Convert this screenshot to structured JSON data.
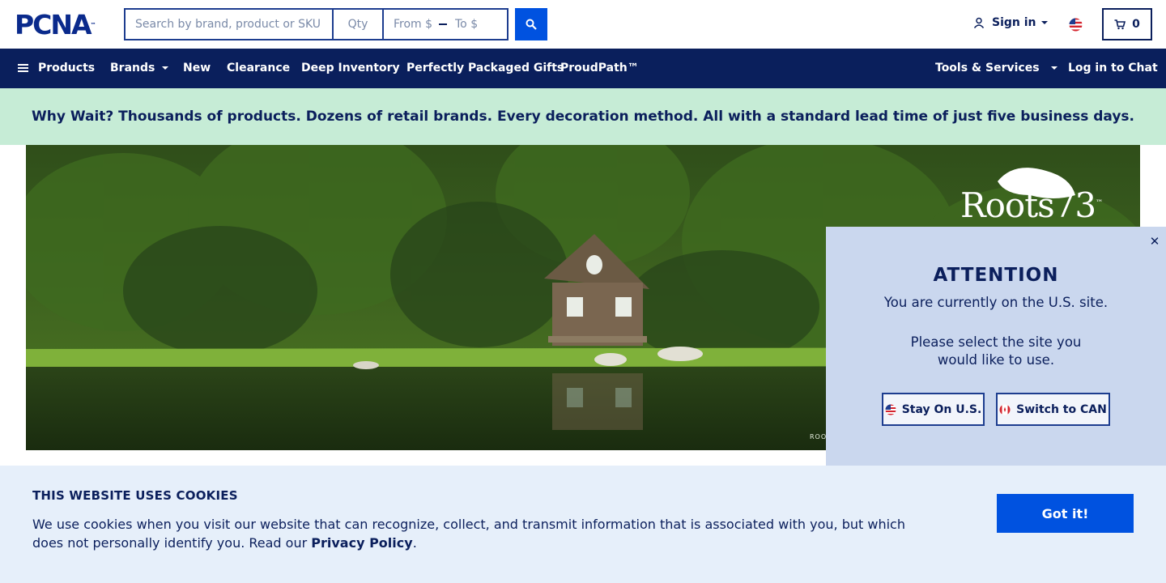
{
  "header": {
    "logo": "PCNA",
    "logo_mark": "™",
    "search": {
      "placeholder": "Search by brand, product or SKU",
      "value": ""
    },
    "qty": {
      "placeholder": "Qty"
    },
    "price_range": {
      "from_placeholder": "From $",
      "to_placeholder": "To $"
    },
    "signin_label": "Sign in",
    "cart_count": "0",
    "icons": [
      "search-icon",
      "user-icon",
      "us-flag-icon",
      "cart-icon"
    ]
  },
  "nav": {
    "items": [
      {
        "label": "Products"
      },
      {
        "label": "Brands"
      },
      {
        "label": "New"
      },
      {
        "label": "Clearance"
      },
      {
        "label": "Deep Inventory"
      },
      {
        "label": "Perfectly Packaged Gifts"
      },
      {
        "label": "ProudPath™"
      }
    ],
    "tools_label": "Tools & Services",
    "chat_label": "Log in to Chat"
  },
  "promo": {
    "text": "Why Wait? Thousands of products. Dozens of retail brands. Every decoration method. All with a standard lead time of just five business days."
  },
  "hero": {
    "brand_text": "Roots73",
    "brand_mark": "™",
    "credit_text": "ROO"
  },
  "site_modal": {
    "title": "ATTENTION",
    "line1": "You are currently on the U.S. site.",
    "line2": "Please select the site you would like to use.",
    "stay_label": "Stay On U.S.",
    "switch_label": "Switch to CAN",
    "close_symbol": "✕"
  },
  "cookies": {
    "title": "THIS WEBSITE USES COOKIES",
    "text": "We use cookies when you visit our website that can recognize, collect, and transmit information that is associated with you, but which does not personally identify you. Read our",
    "link_label": "Privacy Policy",
    "text_end": ".",
    "button_label": "Got it!"
  },
  "colors": {
    "navy": "#0a1f5c",
    "accent_blue": "#0052e0",
    "promo_bg": "#c6ecd6",
    "modal_bg": "#cad7ee",
    "cookie_bg": "#e6effa"
  }
}
